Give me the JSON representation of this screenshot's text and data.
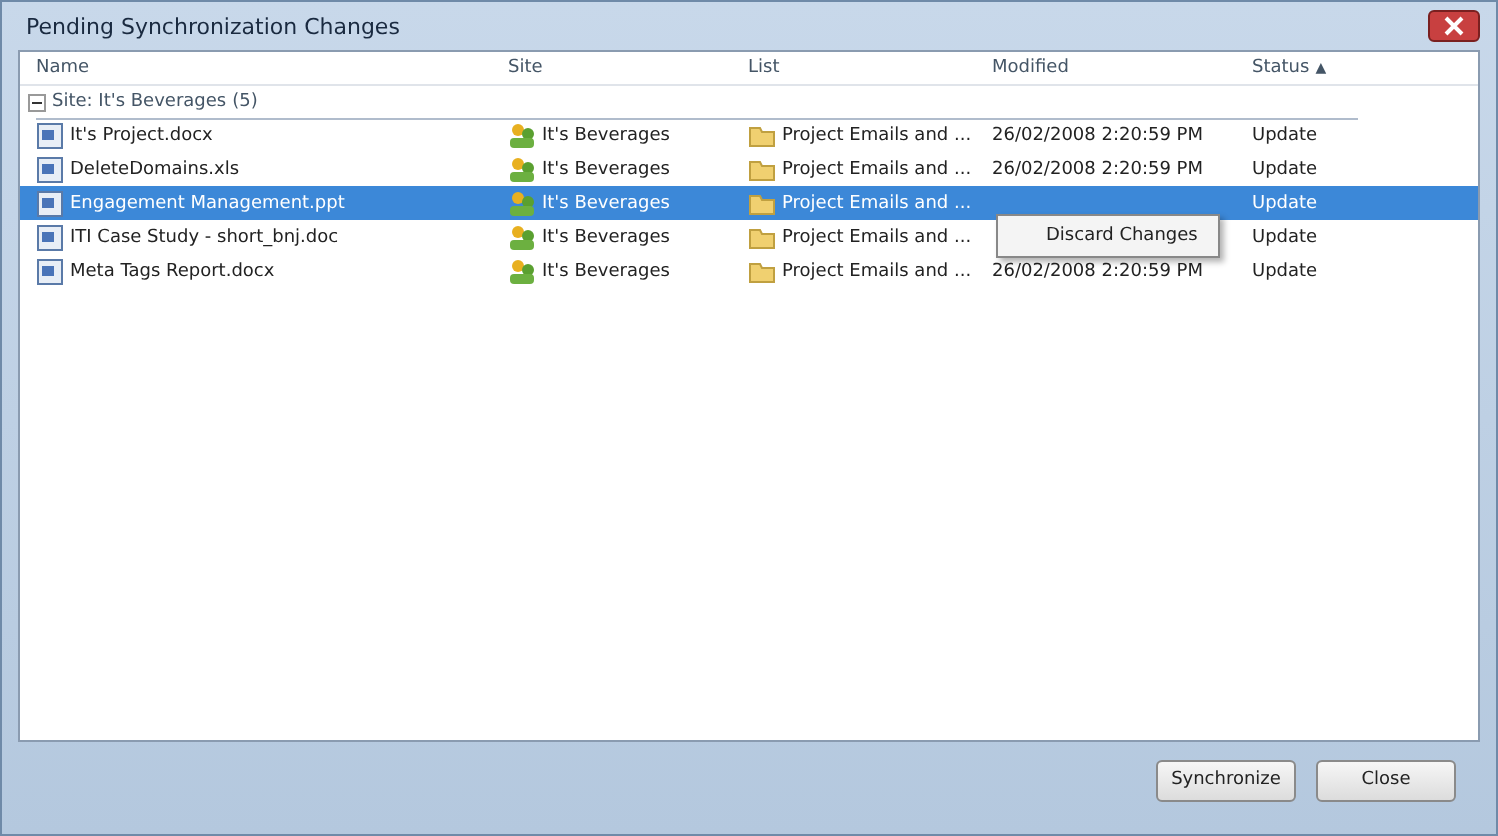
{
  "window": {
    "title": "Pending Synchronization Changes"
  },
  "table": {
    "columns": [
      {
        "label": "Name"
      },
      {
        "label": "Site"
      },
      {
        "label": "List"
      },
      {
        "label": "Modified"
      },
      {
        "label": "Status",
        "sort_arrow": "▲"
      }
    ],
    "group": {
      "label": "Site: It's Beverages",
      "count": "(5)",
      "expanded": true
    },
    "rows": [
      {
        "name": "It's Project.docx",
        "site": "It's Beverages",
        "list": "Project Emails and ...",
        "modified": "26/02/2008 2:20:59 PM",
        "status": "Update",
        "selected": false
      },
      {
        "name": "DeleteDomains.xls",
        "site": "It's Beverages",
        "list": "Project Emails and ...",
        "modified": "26/02/2008 2:20:59 PM",
        "status": "Update",
        "selected": false
      },
      {
        "name": "Engagement Management.ppt",
        "site": "It's Beverages",
        "list": "Project Emails and ...",
        "status": "Update",
        "selected": true
      },
      {
        "name": "ITI Case Study - short_bnj.doc",
        "site": "It's Beverages",
        "list": "Project Emails and ...",
        "status": "Update",
        "selected": false
      },
      {
        "name": "Meta Tags Report.docx",
        "site": "It's Beverages",
        "list": "Project Emails and ...",
        "modified": "26/02/2008 2:20:59 PM",
        "status": "Update",
        "selected": false
      }
    ]
  },
  "context_menu": {
    "items": [
      "Discard Changes"
    ]
  },
  "buttons": [
    "Synchronize",
    "Close"
  ]
}
